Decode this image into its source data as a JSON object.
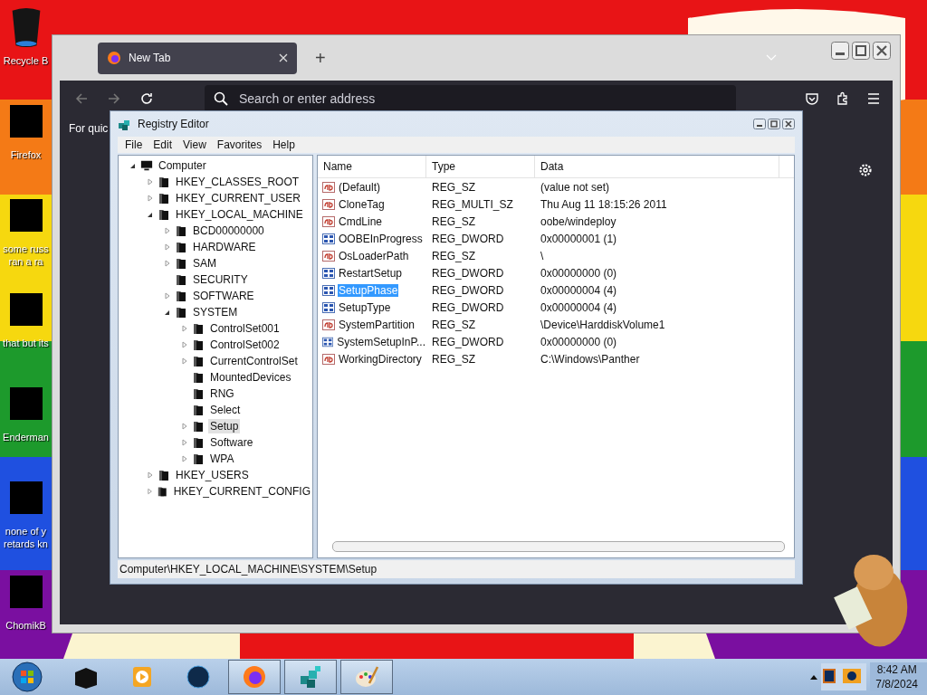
{
  "desktop_icons": [
    {
      "kind": "trash",
      "lines": [
        "Recycle B"
      ]
    },
    {
      "kind": "app",
      "lines": [
        "Firefox"
      ]
    },
    {
      "kind": "app",
      "lines": [
        "some russ",
        "ran a ra"
      ]
    },
    {
      "kind": "app",
      "lines": [
        "that but its"
      ]
    },
    {
      "kind": "app",
      "lines": [
        "Enderman"
      ]
    },
    {
      "kind": "app",
      "lines": [
        "none of y",
        "retards kn"
      ]
    },
    {
      "kind": "app",
      "lines": [
        "ChomikB"
      ]
    }
  ],
  "browser": {
    "tab": {
      "title": "New Tab"
    },
    "new_tab_button": "+",
    "address_placeholder": "Search or enter address",
    "content_text": "For quic"
  },
  "registry_editor": {
    "title": "Registry Editor",
    "menu": [
      "File",
      "Edit",
      "View",
      "Favorites",
      "Help"
    ],
    "tree": [
      {
        "label": "Computer",
        "has_children": true,
        "expanded": true,
        "selected": false,
        "children": [
          {
            "label": "HKEY_CLASSES_ROOT",
            "has_children": true,
            "expanded": false,
            "selected": false
          },
          {
            "label": "HKEY_CURRENT_USER",
            "has_children": true,
            "expanded": false,
            "selected": false
          },
          {
            "label": "HKEY_LOCAL_MACHINE",
            "has_children": true,
            "expanded": true,
            "selected": false,
            "children": [
              {
                "label": "BCD00000000",
                "has_children": true,
                "expanded": false,
                "selected": false
              },
              {
                "label": "HARDWARE",
                "has_children": true,
                "expanded": false,
                "selected": false
              },
              {
                "label": "SAM",
                "has_children": true,
                "expanded": false,
                "selected": false
              },
              {
                "label": "SECURITY",
                "has_children": false,
                "expanded": false,
                "selected": false
              },
              {
                "label": "SOFTWARE",
                "has_children": true,
                "expanded": false,
                "selected": false
              },
              {
                "label": "SYSTEM",
                "has_children": true,
                "expanded": true,
                "selected": false,
                "children": [
                  {
                    "label": "ControlSet001",
                    "has_children": true,
                    "expanded": false,
                    "selected": false
                  },
                  {
                    "label": "ControlSet002",
                    "has_children": true,
                    "expanded": false,
                    "selected": false
                  },
                  {
                    "label": "CurrentControlSet",
                    "has_children": true,
                    "expanded": false,
                    "selected": false
                  },
                  {
                    "label": "MountedDevices",
                    "has_children": false,
                    "expanded": false,
                    "selected": false
                  },
                  {
                    "label": "RNG",
                    "has_children": false,
                    "expanded": false,
                    "selected": false
                  },
                  {
                    "label": "Select",
                    "has_children": false,
                    "expanded": false,
                    "selected": false
                  },
                  {
                    "label": "Setup",
                    "has_children": true,
                    "expanded": false,
                    "selected": true
                  },
                  {
                    "label": "Software",
                    "has_children": true,
                    "expanded": false,
                    "selected": false
                  },
                  {
                    "label": "WPA",
                    "has_children": true,
                    "expanded": false,
                    "selected": false
                  }
                ]
              }
            ]
          },
          {
            "label": "HKEY_USERS",
            "has_children": true,
            "expanded": false,
            "selected": false
          },
          {
            "label": "HKEY_CURRENT_CONFIG",
            "has_children": true,
            "expanded": false,
            "selected": false
          }
        ]
      }
    ],
    "columns": [
      "Name",
      "Type",
      "Data"
    ],
    "values": [
      {
        "kind": "string",
        "name": "(Default)",
        "type": "REG_SZ",
        "data": "(value not set)",
        "selected": false
      },
      {
        "kind": "string",
        "name": "CloneTag",
        "type": "REG_MULTI_SZ",
        "data": "Thu Aug 11 18:15:26 2011",
        "selected": false
      },
      {
        "kind": "string",
        "name": "CmdLine",
        "type": "REG_SZ",
        "data": "oobe/windeploy",
        "selected": false
      },
      {
        "kind": "binary",
        "name": "OOBEInProgress",
        "type": "REG_DWORD",
        "data": "0x00000001 (1)",
        "selected": false
      },
      {
        "kind": "string",
        "name": "OsLoaderPath",
        "type": "REG_SZ",
        "data": "\\",
        "selected": false
      },
      {
        "kind": "binary",
        "name": "RestartSetup",
        "type": "REG_DWORD",
        "data": "0x00000000 (0)",
        "selected": false
      },
      {
        "kind": "binary",
        "name": "SetupPhase",
        "type": "REG_DWORD",
        "data": "0x00000004 (4)",
        "selected": true
      },
      {
        "kind": "binary",
        "name": "SetupType",
        "type": "REG_DWORD",
        "data": "0x00000004 (4)",
        "selected": false
      },
      {
        "kind": "string",
        "name": "SystemPartition",
        "type": "REG_SZ",
        "data": "\\Device\\HarddiskVolume1",
        "selected": false
      },
      {
        "kind": "binary",
        "name": "SystemSetupInP...",
        "type": "REG_DWORD",
        "data": "0x00000000 (0)",
        "selected": false
      },
      {
        "kind": "string",
        "name": "WorkingDirectory",
        "type": "REG_SZ",
        "data": "C:\\Windows\\Panther",
        "selected": false
      }
    ],
    "status_bar": "Computer\\HKEY_LOCAL_MACHINE\\SYSTEM\\Setup"
  },
  "taskbar": {
    "items": [
      {
        "kind": "folder",
        "open": false
      },
      {
        "kind": "media",
        "open": false
      },
      {
        "kind": "globe",
        "open": false
      },
      {
        "kind": "firefox",
        "open": true
      },
      {
        "kind": "registry",
        "open": true
      },
      {
        "kind": "paint",
        "open": true
      }
    ],
    "time": "8:42 AM",
    "date": "7/8/2024"
  }
}
